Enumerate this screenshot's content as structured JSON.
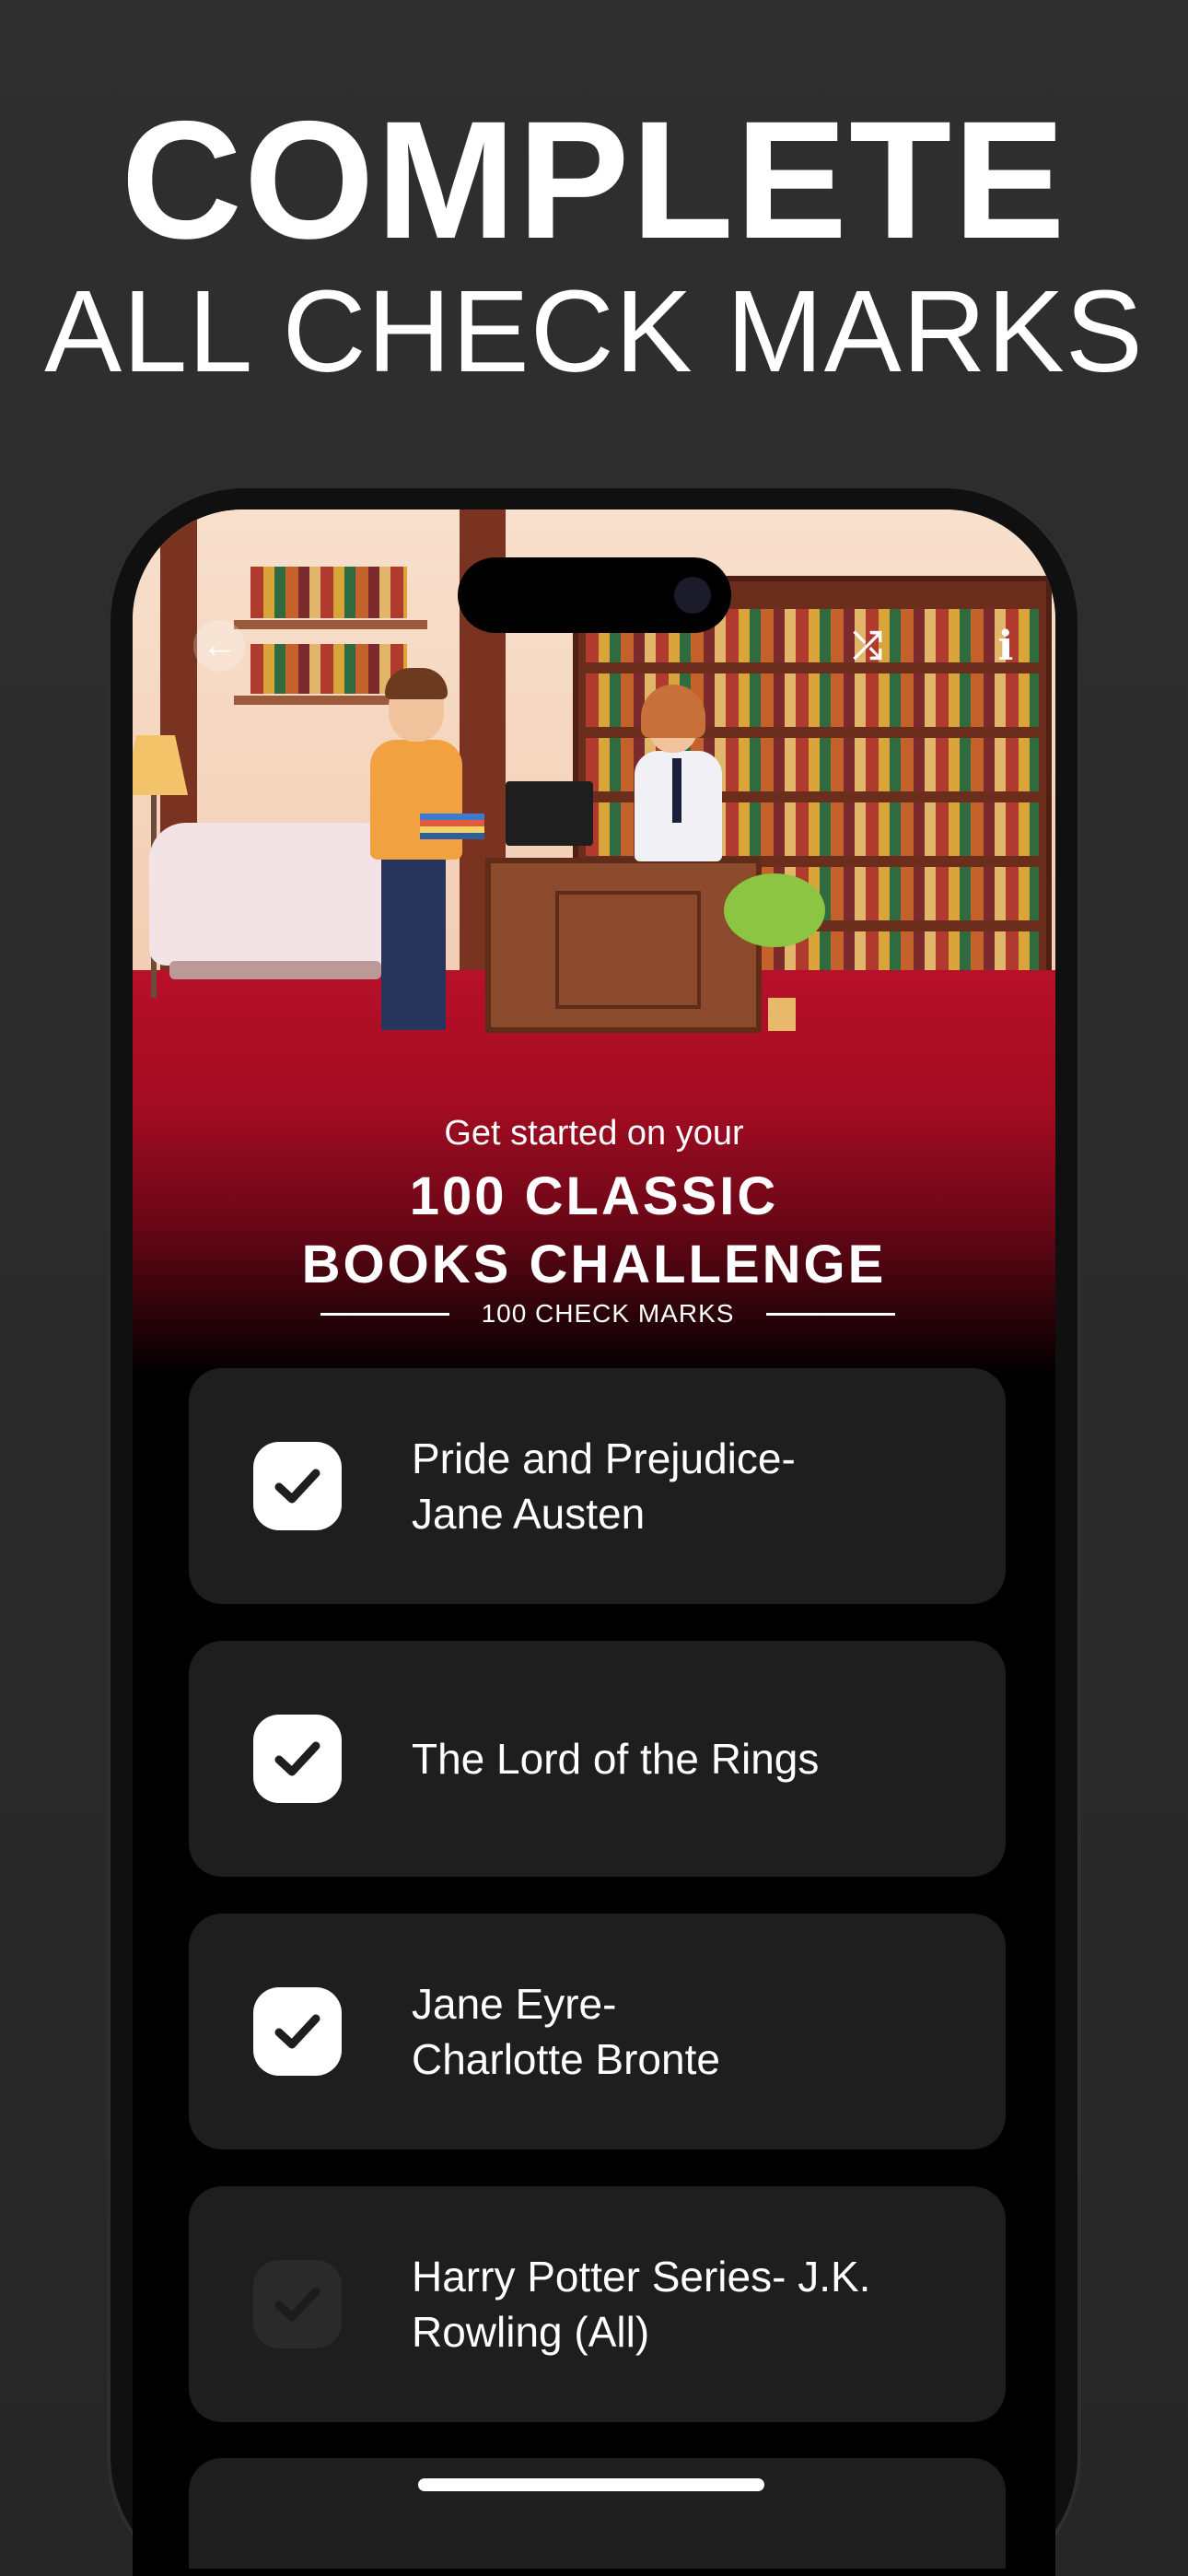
{
  "promo": {
    "headline_line1": "COMPLETE",
    "headline_line2": "ALL CHECK MARKS"
  },
  "header_icons": {
    "back": "back-arrow-icon",
    "shuffle": "shuffle-icon",
    "info": "info-icon",
    "back_glyph": "←",
    "shuffle_glyph": "⤮",
    "info_glyph": "i"
  },
  "challenge": {
    "intro": "Get started on your",
    "title": "100 CLASSIC\nBOOKS CHALLENGE",
    "count_label": "100 CHECK MARKS"
  },
  "items": [
    {
      "label": "Pride and Prejudice-\nJane Austen",
      "checked": true
    },
    {
      "label": "The Lord of the Rings",
      "checked": true
    },
    {
      "label": "Jane Eyre-\nCharlotte Bronte",
      "checked": true
    },
    {
      "label": "Harry Potter Series- J.K.\nRowling (All)",
      "checked": false
    }
  ],
  "colors": {
    "background": "#2b2b2b",
    "card": "#1e1e1e",
    "accent_red": "#a20c22",
    "text": "#ffffff"
  }
}
